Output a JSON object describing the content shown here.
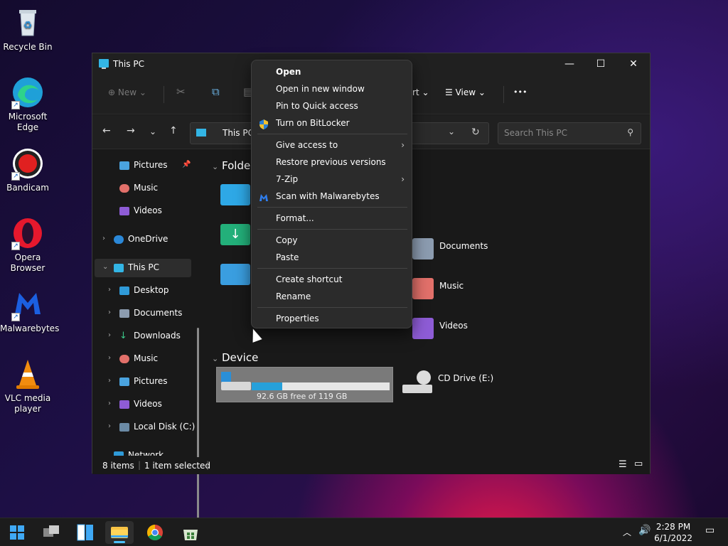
{
  "desktop": {
    "icons": [
      {
        "label": "Recycle Bin"
      },
      {
        "label": "Microsoft Edge"
      },
      {
        "label": "Bandicam"
      },
      {
        "label": "Opera Browser"
      },
      {
        "label": "Malwarebytes"
      },
      {
        "label": "VLC media player"
      }
    ]
  },
  "window": {
    "title": "This PC",
    "controls": {
      "minimize": "—",
      "maximize": "☐",
      "close": "✕"
    }
  },
  "cmdbar": {
    "new_label": "New",
    "sort_label": "rt",
    "view_label": "View",
    "more_label": "•••"
  },
  "address": {
    "path": "This PC",
    "search_placeholder": "Search This PC"
  },
  "sidebar": {
    "items": [
      {
        "label": "Pictures"
      },
      {
        "label": "Music"
      },
      {
        "label": "Videos"
      },
      {
        "label": "OneDrive"
      },
      {
        "label": "This PC"
      },
      {
        "label": "Desktop"
      },
      {
        "label": "Documents"
      },
      {
        "label": "Downloads"
      },
      {
        "label": "Music"
      },
      {
        "label": "Pictures"
      },
      {
        "label": "Videos"
      },
      {
        "label": "Local Disk (C:)"
      },
      {
        "label": "Network"
      }
    ]
  },
  "content": {
    "folders_heading": "Folder",
    "devices_heading": "Device",
    "folders": [
      {
        "label": "Documents"
      },
      {
        "label": "Music"
      },
      {
        "label": "Videos"
      }
    ],
    "drive_free": "92.6 GB free of 119 GB",
    "drive_used_fraction": 0.22,
    "cd_drive": "CD Drive (E:)"
  },
  "status": {
    "items": "8 items",
    "selected": "1 item selected"
  },
  "context_menu": {
    "items": [
      {
        "label": "Open"
      },
      {
        "label": "Open in new window"
      },
      {
        "label": "Pin to Quick access"
      },
      {
        "label": "Turn on BitLocker"
      },
      {
        "label": "Give access to"
      },
      {
        "label": "Restore previous versions"
      },
      {
        "label": "7-Zip"
      },
      {
        "label": "Scan with Malwarebytes"
      },
      {
        "label": "Format..."
      },
      {
        "label": "Copy"
      },
      {
        "label": "Paste"
      },
      {
        "label": "Create shortcut"
      },
      {
        "label": "Rename"
      },
      {
        "label": "Properties"
      }
    ]
  },
  "taskbar": {
    "time": "2:28 PM",
    "date": "6/1/2022"
  },
  "colors": {
    "accent": "#26a0da",
    "folder_blue": "#2ea8e6",
    "window_bg": "#191919"
  }
}
